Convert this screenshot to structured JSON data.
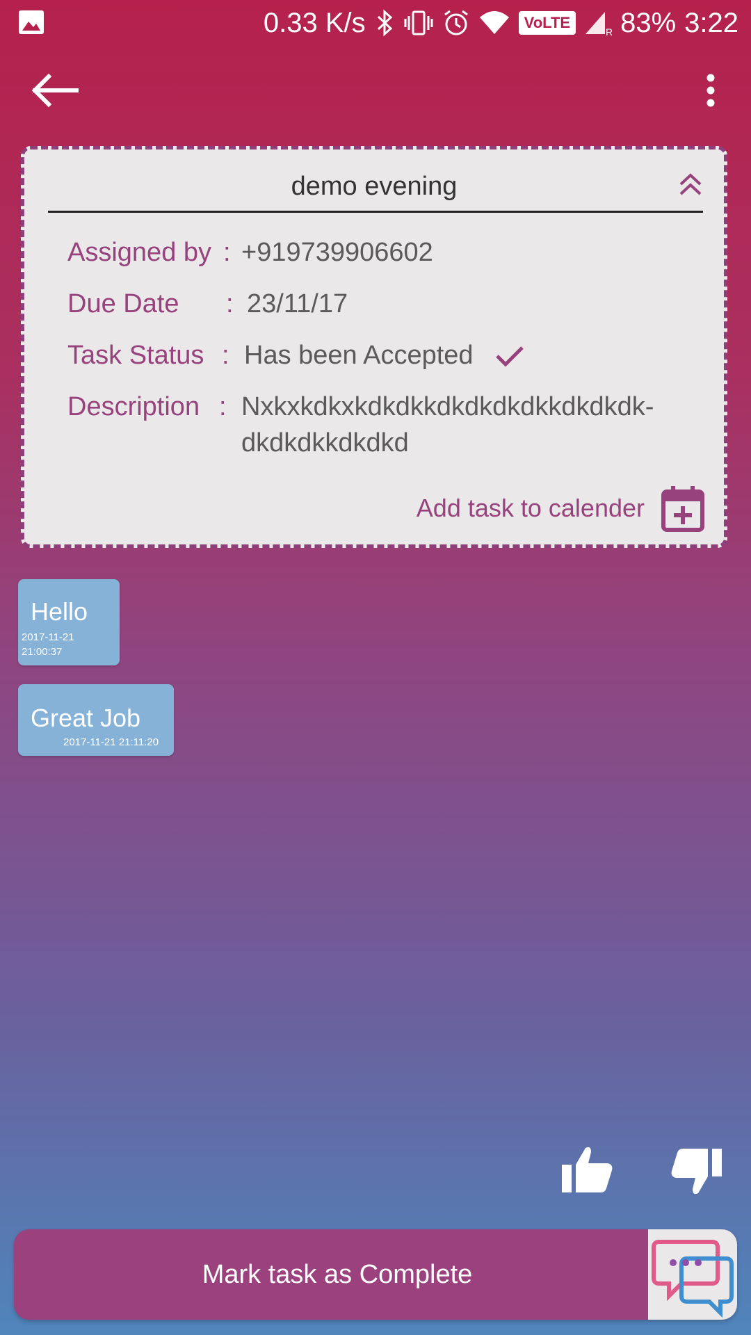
{
  "status_bar": {
    "speed": "0.33 K/s",
    "volte": "VoLTE",
    "battery": "83%",
    "time": "3:22"
  },
  "task": {
    "title": "demo evening",
    "rows": [
      {
        "label": "Assigned by",
        "sep": ":",
        "value": "+919739906602"
      },
      {
        "label": "Due Date",
        "sep": ":",
        "value": "23/11/17"
      },
      {
        "label": "Task Status",
        "sep": ":",
        "value": "Has been Accepted"
      },
      {
        "label": "Description",
        "sep": ":",
        "value_line1": "Nxkxkdkxkdkdkkdkdkdkdkkdkdkdk-",
        "value_line2": "dkdkdkkdkdkd"
      }
    ],
    "calendar_label": "Add task to calender"
  },
  "messages": [
    {
      "text": "Hello",
      "ts_line1": "2017-11-21",
      "ts_line2": "21:00:37"
    },
    {
      "text": "Great Job",
      "ts": "2017-11-21 21:11:20"
    }
  ],
  "actions": {
    "complete_label": "Mark task as Complete"
  },
  "colors": {
    "accent": "#97427D",
    "bubble": "#85B2D6",
    "card": "#EAE8E9"
  }
}
